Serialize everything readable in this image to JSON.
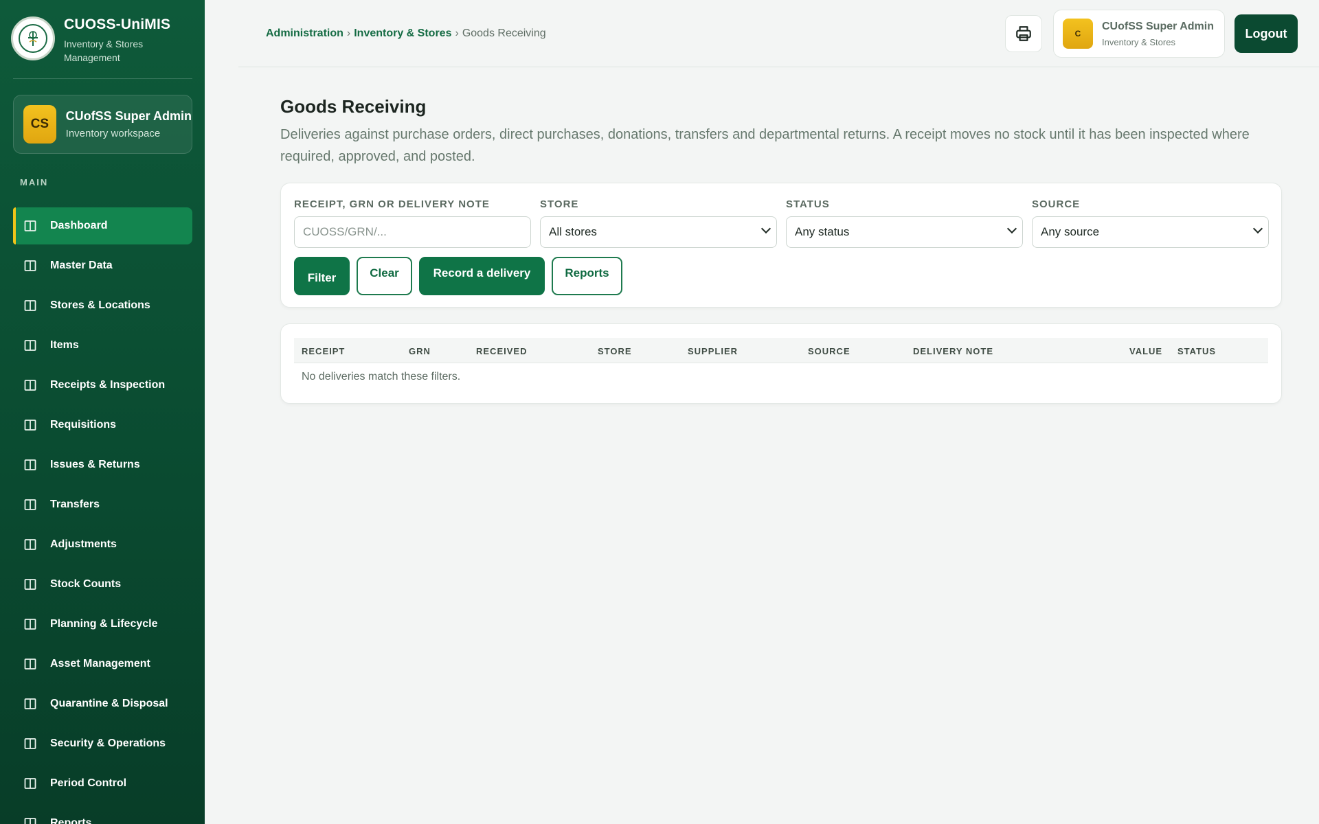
{
  "brand": {
    "title": "CUOSS-UniMIS",
    "subtitle": "Inventory & Stores Management"
  },
  "profile": {
    "initials": "CS",
    "name": "CUofSS Super Admin",
    "role": "Inventory workspace"
  },
  "sidebar": {
    "section_label": "MAIN",
    "items": [
      {
        "label": "Dashboard",
        "active": true
      },
      {
        "label": "Master Data"
      },
      {
        "label": "Stores & Locations"
      },
      {
        "label": "Items"
      },
      {
        "label": "Receipts & Inspection"
      },
      {
        "label": "Requisitions"
      },
      {
        "label": "Issues & Returns"
      },
      {
        "label": "Transfers"
      },
      {
        "label": "Adjustments"
      },
      {
        "label": "Stock Counts"
      },
      {
        "label": "Planning & Lifecycle"
      },
      {
        "label": "Asset Management"
      },
      {
        "label": "Quarantine & Disposal"
      },
      {
        "label": "Security & Operations"
      },
      {
        "label": "Period Control"
      },
      {
        "label": "Reports"
      }
    ]
  },
  "topbar": {
    "breadcrumb": [
      "Administration",
      "Inventory & Stores",
      "Goods Receiving"
    ],
    "separator": "›",
    "user": {
      "initial": "C",
      "name": "CUofSS Super Admin",
      "role": "Inventory & Stores"
    },
    "logout_label": "Logout",
    "print_icon": "printer-icon"
  },
  "page": {
    "title": "Goods Receiving",
    "description": "Deliveries against purchase orders, direct purchases, donations, transfers and departmental returns. A receipt moves no stock until it has been inspected where required, approved, and posted."
  },
  "filters": {
    "search": {
      "label": "RECEIPT, GRN OR DELIVERY NOTE",
      "placeholder": "CUOSS/GRN/..."
    },
    "store": {
      "label": "STORE",
      "value": "All stores"
    },
    "status": {
      "label": "STATUS",
      "value": "Any status"
    },
    "source": {
      "label": "SOURCE",
      "value": "Any source"
    },
    "buttons": {
      "filter": "Filter",
      "clear": "Clear",
      "record": "Record a delivery",
      "reports": "Reports"
    }
  },
  "table": {
    "columns": [
      "RECEIPT",
      "GRN",
      "RECEIVED",
      "STORE",
      "SUPPLIER",
      "SOURCE",
      "DELIVERY NOTE",
      "VALUE",
      "STATUS"
    ],
    "empty_message": "No deliveries match these filters."
  },
  "colors": {
    "primary": "#0f7447",
    "sidebar": "#0e5a3a",
    "accent": "#f0c419"
  }
}
